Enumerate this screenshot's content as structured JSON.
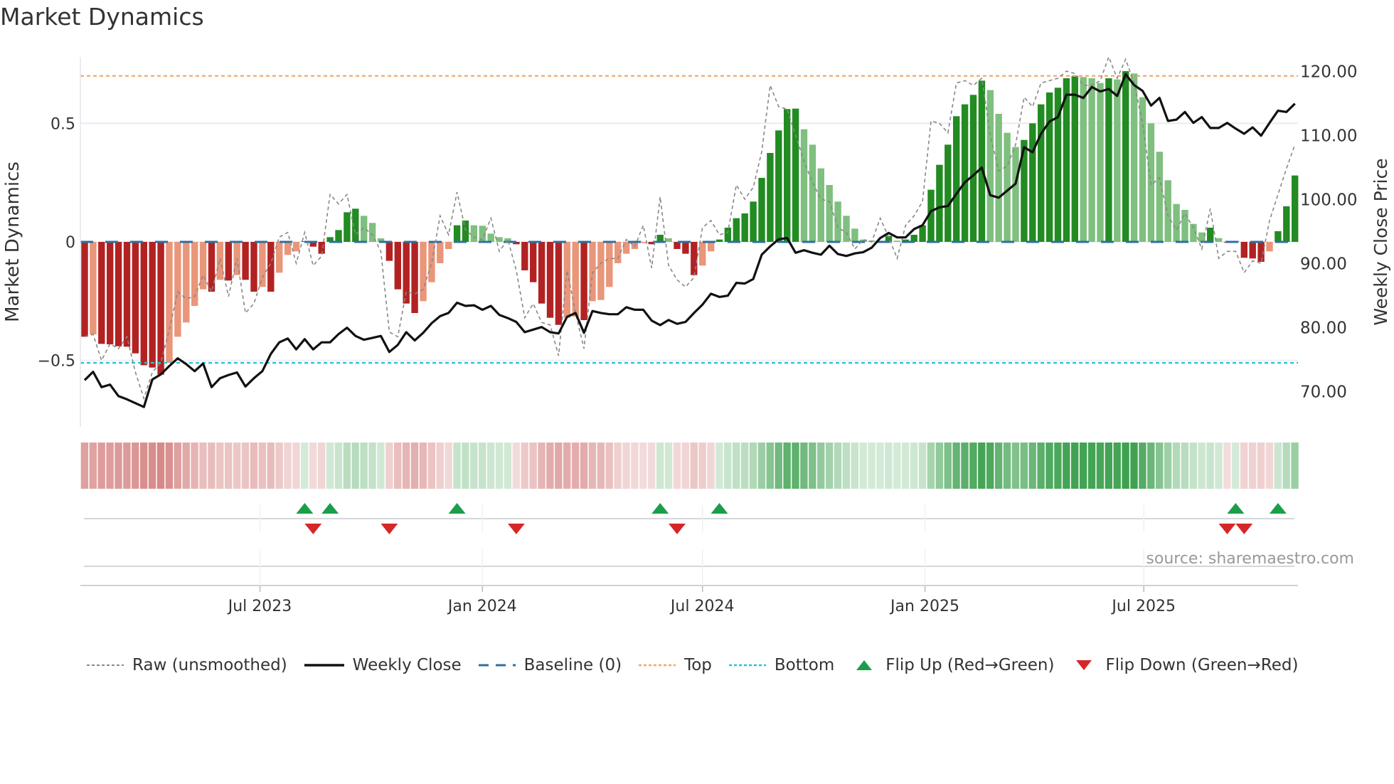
{
  "title": "Market Dynamics",
  "source": "source: sharemaestro.com",
  "legend": {
    "raw": "Raw (unsmoothed)",
    "close": "Weekly Close",
    "baseline": "Baseline (0)",
    "top": "Top",
    "bottom": "Bottom",
    "flip_up": "Flip Up (Red→Green)",
    "flip_down": "Flip Down (Green→Red)"
  },
  "colors": {
    "pos_strong": "#228b22",
    "pos_weak": "#7fbf7f",
    "neg_strong": "#b22222",
    "neg_weak": "#e9967a",
    "raw": "#888888",
    "close": "#111111",
    "baseline": "#2e6f9e",
    "top": "#f4a460",
    "bottom": "#22c4d4",
    "flip_up": "#1a9e4a",
    "flip_down": "#d62728"
  },
  "chart_data": {
    "type": "bar",
    "title": "Market Dynamics",
    "ylabel": "Market Dynamics",
    "y2label": "Weekly Close Price",
    "x_start": "2023-02-06",
    "x_interval": "weekly",
    "ylim": [
      -0.78,
      0.78
    ],
    "y2lim": [
      64.5,
      122.3
    ],
    "yticks": [
      {
        "v": 0.5,
        "label": "0.5"
      },
      {
        "v": 0,
        "label": "0"
      },
      {
        "v": -0.5,
        "label": "−0.5"
      }
    ],
    "y2ticks": [
      {
        "v": 120,
        "label": "120.00"
      },
      {
        "v": 110,
        "label": "110.00"
      },
      {
        "v": 100,
        "label": "100.00"
      },
      {
        "v": 90,
        "label": "90.00"
      },
      {
        "v": 80,
        "label": "80.00"
      },
      {
        "v": 70,
        "label": "70.00"
      }
    ],
    "xticks": [
      {
        "date": "2023-07-01",
        "label": "Jul 2023"
      },
      {
        "date": "2024-01-01",
        "label": "Jan 2024"
      },
      {
        "date": "2024-07-01",
        "label": "Jul 2024"
      },
      {
        "date": "2025-01-01",
        "label": "Jan 2025"
      },
      {
        "date": "2025-07-01",
        "label": "Jul 2025"
      }
    ],
    "levels": {
      "baseline": 0,
      "top": 0.7,
      "bottom": -0.51
    },
    "smoothed": [
      -0.4,
      -0.39,
      -0.43,
      -0.432,
      -0.44,
      -0.442,
      -0.47,
      -0.52,
      -0.53,
      -0.56,
      -0.51,
      -0.4,
      -0.34,
      -0.27,
      -0.2,
      -0.21,
      -0.16,
      -0.163,
      -0.14,
      -0.16,
      -0.21,
      -0.19,
      -0.21,
      -0.13,
      -0.055,
      -0.04,
      0.003,
      -0.02,
      -0.05,
      0.02,
      0.05,
      0.125,
      0.14,
      0.11,
      0.08,
      0.015,
      -0.08,
      -0.2,
      -0.26,
      -0.3,
      -0.25,
      -0.17,
      -0.09,
      -0.03,
      0.07,
      0.09,
      0.07,
      0.068,
      0.035,
      0.02,
      0.015,
      -0.01,
      -0.12,
      -0.17,
      -0.26,
      -0.32,
      -0.35,
      -0.32,
      -0.315,
      -0.33,
      -0.25,
      -0.245,
      -0.19,
      -0.09,
      -0.05,
      -0.03,
      -0.005,
      -0.01,
      0.03,
      0.015,
      -0.03,
      -0.05,
      -0.14,
      -0.1,
      -0.04,
      0.01,
      0.06,
      0.1,
      0.12,
      0.17,
      0.27,
      0.375,
      0.47,
      0.56,
      0.562,
      0.475,
      0.41,
      0.31,
      0.24,
      0.17,
      0.11,
      0.056,
      0.01,
      0.006,
      0.004,
      0.025,
      0.005,
      0.01,
      0.03,
      0.07,
      0.22,
      0.325,
      0.41,
      0.53,
      0.58,
      0.62,
      0.68,
      0.64,
      0.54,
      0.46,
      0.4,
      0.43,
      0.5,
      0.58,
      0.63,
      0.65,
      0.69,
      0.7,
      0.695,
      0.69,
      0.67,
      0.69,
      0.685,
      0.72,
      0.71,
      0.61,
      0.5,
      0.38,
      0.26,
      0.16,
      0.135,
      0.076,
      0.04,
      0.06,
      0.016,
      -0.003,
      0.003,
      -0.067,
      -0.07,
      -0.084,
      -0.04,
      0.045,
      0.15,
      0.28
    ],
    "raw": [
      -0.4,
      -0.39,
      -0.5,
      -0.43,
      -0.45,
      -0.4,
      -0.55,
      -0.66,
      -0.55,
      -0.51,
      -0.37,
      -0.21,
      -0.24,
      -0.23,
      -0.14,
      -0.21,
      -0.07,
      -0.23,
      -0.07,
      -0.3,
      -0.26,
      -0.15,
      -0.09,
      0.02,
      0.04,
      -0.09,
      0.04,
      -0.1,
      -0.06,
      0.2,
      0.16,
      0.2,
      0.03,
      0.06,
      0.03,
      -0.04,
      -0.38,
      -0.4,
      -0.21,
      -0.22,
      -0.2,
      -0.09,
      0.11,
      0.03,
      0.21,
      0.05,
      0.02,
      0.01,
      0.1,
      -0.04,
      0.01,
      -0.12,
      -0.32,
      -0.26,
      -0.34,
      -0.35,
      -0.48,
      -0.12,
      -0.3,
      -0.45,
      -0.13,
      -0.09,
      -0.07,
      -0.07,
      0.01,
      -0.02,
      0.07,
      -0.11,
      0.19,
      -0.1,
      -0.16,
      -0.19,
      -0.15,
      0.06,
      0.09,
      0.03,
      0.04,
      0.24,
      0.18,
      0.23,
      0.38,
      0.66,
      0.57,
      0.56,
      0.45,
      0.34,
      0.25,
      0.18,
      0.17,
      0.06,
      0.04,
      -0.03,
      0.01,
      0.0,
      0.1,
      0.02,
      -0.07,
      0.07,
      0.11,
      0.17,
      0.51,
      0.5,
      0.46,
      0.67,
      0.68,
      0.66,
      0.69,
      0.45,
      0.3,
      0.32,
      0.41,
      0.61,
      0.57,
      0.67,
      0.68,
      0.69,
      0.72,
      0.71,
      0.66,
      0.66,
      0.68,
      0.78,
      0.69,
      0.77,
      0.67,
      0.5,
      0.24,
      0.27,
      0.11,
      0.05,
      0.12,
      0.06,
      -0.03,
      0.14,
      -0.07,
      -0.04,
      -0.04,
      -0.13,
      -0.08,
      -0.09,
      0.09,
      0.2,
      0.31,
      0.41
    ],
    "close": [
      71.8,
      73.1,
      70.7,
      71.1,
      69.3,
      68.8,
      68.2,
      67.6,
      71.9,
      72.7,
      74.0,
      75.2,
      74.3,
      73.2,
      74.4,
      70.7,
      72.1,
      72.6,
      73.0,
      70.8,
      72.1,
      73.2,
      75.9,
      77.7,
      78.3,
      76.6,
      78.2,
      76.6,
      77.7,
      77.7,
      79.0,
      80.0,
      78.7,
      78.1,
      78.4,
      78.7,
      76.2,
      77.3,
      79.3,
      78.0,
      79.2,
      80.7,
      81.8,
      82.3,
      83.9,
      83.4,
      83.5,
      82.8,
      83.4,
      82.0,
      81.5,
      80.9,
      79.3,
      79.7,
      80.1,
      79.3,
      79.1,
      81.7,
      82.3,
      79.2,
      82.6,
      82.3,
      82.1,
      82.1,
      83.2,
      82.8,
      82.8,
      81.1,
      80.4,
      81.2,
      80.6,
      80.9,
      82.3,
      83.6,
      85.3,
      84.8,
      85.0,
      87.0,
      86.9,
      87.6,
      91.4,
      92.7,
      93.8,
      94.0,
      91.7,
      92.1,
      91.7,
      91.4,
      92.8,
      91.5,
      91.2,
      91.6,
      91.8,
      92.5,
      94.0,
      94.8,
      94.1,
      94.1,
      95.4,
      96.0,
      98.2,
      98.8,
      99.0,
      100.9,
      102.7,
      103.8,
      105.0,
      100.7,
      100.3,
      101.4,
      102.5,
      108.2,
      107.4,
      110.3,
      112.2,
      112.9,
      116.4,
      116.4,
      115.9,
      117.6,
      116.9,
      117.3,
      116.2,
      119.6,
      117.9,
      117.0,
      114.7,
      115.9,
      112.3,
      112.5,
      113.7,
      112.0,
      112.9,
      111.2,
      111.2,
      112.0,
      111.1,
      110.3,
      111.3,
      110.0,
      112.0,
      113.9,
      113.7,
      115.0
    ],
    "flips_up": [
      "2023-08-07",
      "2023-08-28",
      "2023-12-11",
      "2024-05-27",
      "2024-07-15",
      "2025-09-15",
      "2025-10-20"
    ],
    "flips_down": [
      "2023-08-14",
      "2023-10-16",
      "2024-01-29",
      "2024-06-10",
      "2025-09-08",
      "2025-09-22"
    ]
  }
}
